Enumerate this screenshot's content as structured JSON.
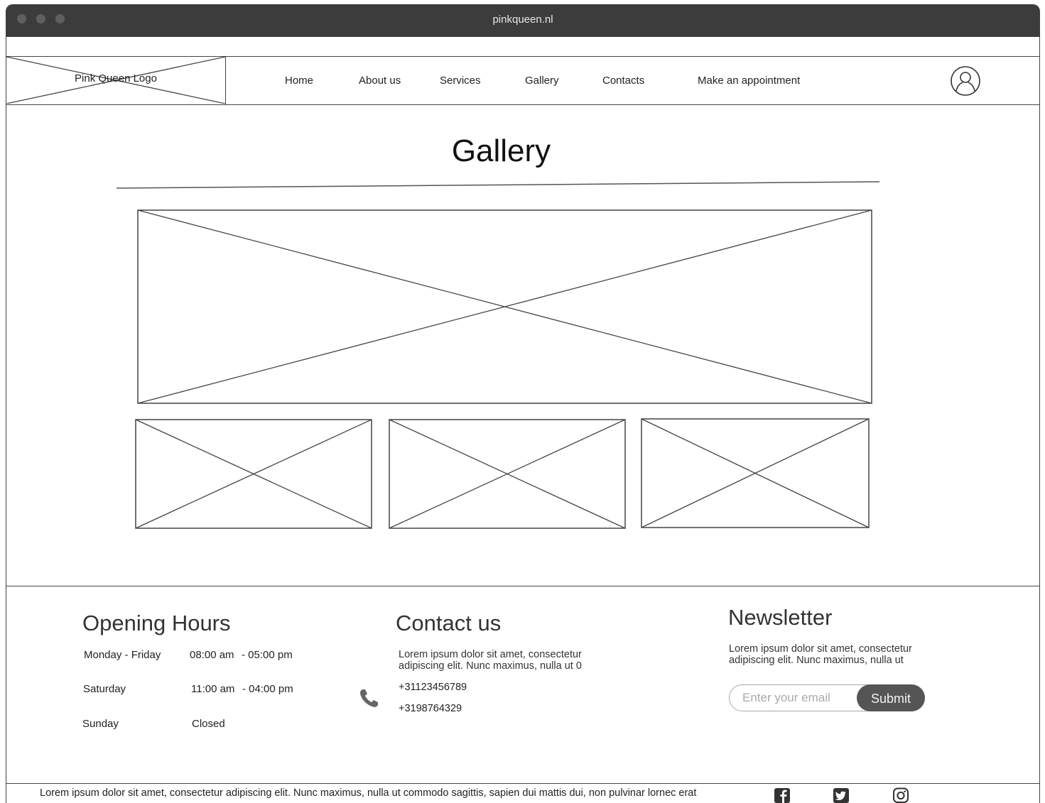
{
  "browser": {
    "url": "pinkqueen.nl"
  },
  "header": {
    "logo_text": "Pink Queen Logo",
    "nav": [
      "Home",
      "About us",
      "Services",
      "Gallery",
      "Contacts",
      "Make an appointment"
    ]
  },
  "gallery": {
    "title": "Gallery"
  },
  "footer": {
    "hours": {
      "heading": "Opening Hours",
      "rows": [
        {
          "day": "Monday - Friday",
          "open": "08:00 am",
          "close": "- 05:00 pm"
        },
        {
          "day": "Saturday",
          "open": "11:00 am",
          "close": "- 04:00 pm"
        },
        {
          "day": "Sunday",
          "open": "Closed",
          "close": ""
        }
      ]
    },
    "contact": {
      "heading": "Contact us",
      "text_line1": "Lorem ipsum dolor sit amet, consectetur",
      "text_line2": "adipiscing elit. Nunc maximus, nulla ut 0",
      "phone1": "+31123456789",
      "phone2": "+3198764329"
    },
    "newsletter": {
      "heading": "Newsletter",
      "text_line1": "Lorem ipsum dolor sit amet, consectetur",
      "text_line2": "adipiscing elit. Nunc maximus, nulla ut",
      "email_placeholder": "Enter your email",
      "submit_label": "Submit"
    },
    "legal": "Lorem ipsum dolor sit amet, consectetur adipiscing elit. Nunc maximus, nulla ut commodo sagittis, sapien dui mattis dui, non pulvinar lornec erat",
    "social_icons": [
      "facebook-icon",
      "twitter-icon",
      "instagram-icon"
    ]
  },
  "colors": {
    "chrome": "#3c3c3c",
    "button": "#555555",
    "line": "#444444"
  }
}
